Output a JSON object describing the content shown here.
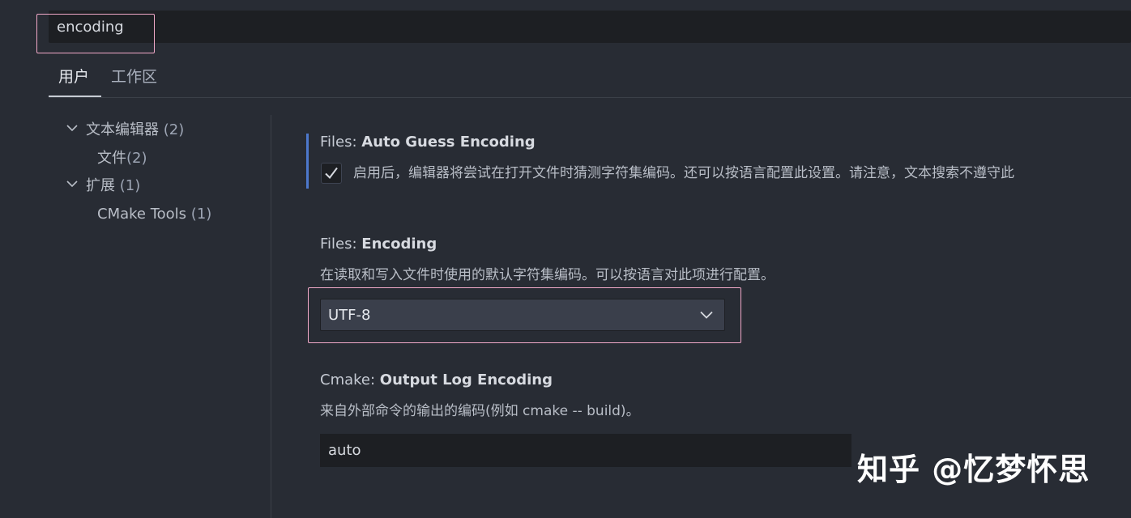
{
  "search": {
    "value": "encoding"
  },
  "tabs": [
    {
      "label": "用户",
      "active": true
    },
    {
      "label": "工作区",
      "active": false
    }
  ],
  "toc": [
    {
      "label": "文本编辑器",
      "count": "(2)",
      "expanded": true
    },
    {
      "label": "文件",
      "count": "(2)"
    },
    {
      "label": "扩展",
      "count": "(1)",
      "expanded": true
    },
    {
      "label": "CMake Tools",
      "count": "(1)"
    }
  ],
  "settings": {
    "auto_guess": {
      "category": "Files: ",
      "name": "Auto Guess Encoding",
      "description": "启用后，编辑器将尝试在打开文件时猜测字符集编码。还可以按语言配置此设置。请注意，文本搜索不遵守此",
      "checked": true
    },
    "encoding": {
      "category": "Files: ",
      "name": "Encoding",
      "description": "在读取和写入文件时使用的默认字符集编码。可以按语言对此项进行配置。",
      "value": "UTF-8"
    },
    "output_log": {
      "category": "Cmake: ",
      "name": "Output Log Encoding",
      "description": "来自外部命令的输出的编码(例如 cmake -- build)。",
      "value": "auto"
    }
  },
  "watermark": "知乎 @忆梦怀思",
  "colors": {
    "background": "#282c34",
    "input_background": "#1d1f23",
    "highlight": "#f2a9c9",
    "focus": "#4d78cc"
  }
}
